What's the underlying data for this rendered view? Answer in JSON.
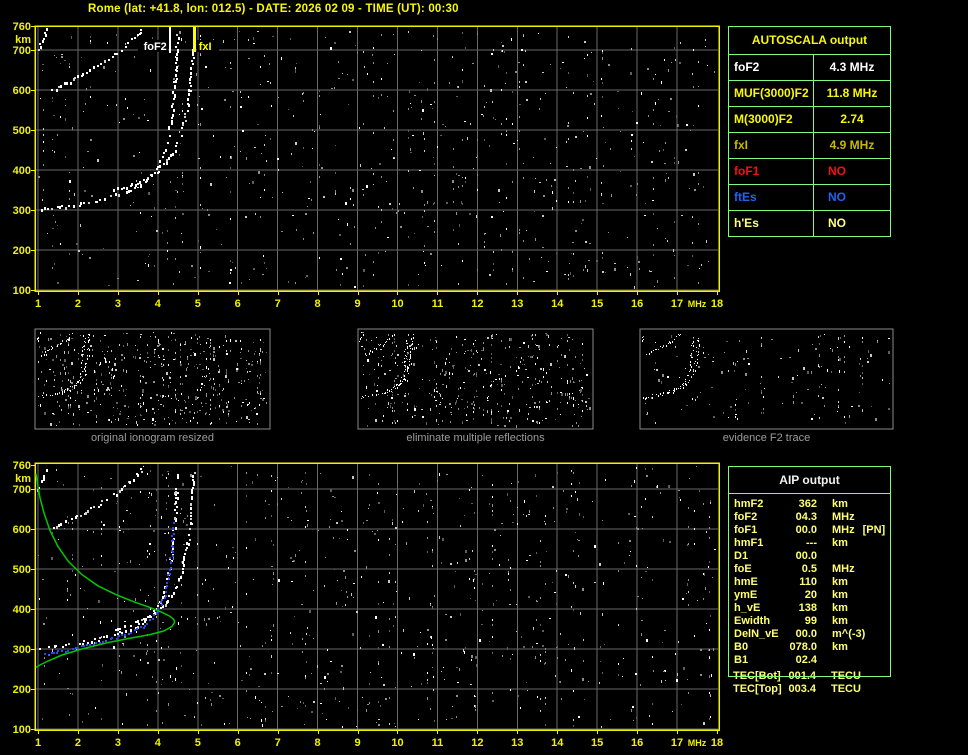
{
  "title": "Rome (lat: +41.8, lon: 012.5) - DATE: 2026 02 09 - TIME (UT): 00:30",
  "colors": {
    "background": "#000000",
    "title_yellow": "#f8f800",
    "axis_yellow": "#f2f200",
    "grid_gray": "#696969",
    "panel_border_gray": "#8a8a8a",
    "caption_gray": "#9c9c9c",
    "table_border_green": "#80fb80",
    "profile_green": "#00c800",
    "trace_blue": "#2a46f0",
    "status_red": "#f21212",
    "status_blue": "#1e64f0",
    "olive_yellow": "#c9b800",
    "pale_yellow": "#ffff73",
    "white": "#ffffff"
  },
  "autoscala_table": {
    "header": "AUTOSCALA output",
    "rows": [
      {
        "label": "foF2",
        "value": "4.3 MHz",
        "color": "#ffffff"
      },
      {
        "label": "MUF(3000)F2",
        "value": "11.8 MHz",
        "color": "#f8f800"
      },
      {
        "label": "M(3000)F2",
        "value": "2.74",
        "color": "#f8f800"
      },
      {
        "label": "fxI",
        "value": "4.9 MHz",
        "color": "#c9b800"
      },
      {
        "label": "foF1",
        "value": "NO",
        "color": "#f21212"
      },
      {
        "label": "ftEs",
        "value": "NO",
        "color": "#1e64f0"
      },
      {
        "label": "h'Es",
        "value": "NO",
        "color": "#ffff7a"
      }
    ]
  },
  "aip_table": {
    "header": "AIP output",
    "rows": [
      {
        "label": "hmF2",
        "value": "362",
        "unit": "km",
        "extra": ""
      },
      {
        "label": "foF2",
        "value": "04.3",
        "unit": "MHz",
        "extra": ""
      },
      {
        "label": "foF1",
        "value": "00.0",
        "unit": "MHz",
        "extra": "[PN]"
      },
      {
        "label": "hmF1",
        "value": "---",
        "unit": "km",
        "extra": ""
      },
      {
        "label": "D1",
        "value": "00.0",
        "unit": "",
        "extra": ""
      },
      {
        "label": "foE",
        "value": "0.5",
        "unit": "MHz",
        "extra": ""
      },
      {
        "label": "hmE",
        "value": "110",
        "unit": "km",
        "extra": ""
      },
      {
        "label": "ymE",
        "value": "20",
        "unit": "km",
        "extra": ""
      },
      {
        "label": "h_vE",
        "value": "138",
        "unit": "km",
        "extra": ""
      },
      {
        "label": "Ewidth",
        "value": "99",
        "unit": "km",
        "extra": ""
      },
      {
        "label": "DelN_vE",
        "value": "00.0",
        "unit": "m^(-3)",
        "extra": ""
      },
      {
        "label": "B0",
        "value": "078.0",
        "unit": "km",
        "extra": ""
      },
      {
        "label": "B1",
        "value": "02.4",
        "unit": "",
        "extra": ""
      }
    ],
    "tec_rows": [
      {
        "label": "TEC[Bot]",
        "value": "001.4",
        "unit": "TECU"
      },
      {
        "label": "TEC[Top]",
        "value": "003.4",
        "unit": "TECU"
      }
    ]
  },
  "panels": [
    {
      "caption": "original ionogram resized"
    },
    {
      "caption": "eliminate multiple reflections"
    },
    {
      "caption": "evidence F2 trace"
    }
  ],
  "chart_data": {
    "type": "scatter",
    "description": "Ionogram: echo virtual height (km) vs sounding frequency (MHz), shown in a top plot with foF2/fxI markers and a bottom plot with the autoscaled F2 trace (blue) and electron density profile (green)",
    "xlabel": "MHz",
    "ylabel": "km",
    "xlim": [
      1,
      18
    ],
    "ylim": [
      100,
      760
    ],
    "grid": true,
    "x_ticks": [
      1,
      2,
      3,
      4,
      5,
      6,
      7,
      8,
      9,
      10,
      11,
      12,
      13,
      14,
      15,
      16,
      17,
      18
    ],
    "y_ticks": [
      760,
      700,
      600,
      500,
      400,
      300,
      200,
      100
    ],
    "markers": [
      {
        "label": "foF2",
        "freq": 4.3,
        "color": "#ffffff"
      },
      {
        "label": "fxI",
        "freq": 4.9,
        "color": "#ffff00"
      }
    ],
    "traces": {
      "f2_o_mode_virtual_height": [
        [
          1.05,
          303
        ],
        [
          1.3,
          306
        ],
        [
          1.6,
          310
        ],
        [
          2.0,
          316
        ],
        [
          2.4,
          324
        ],
        [
          2.8,
          334
        ],
        [
          3.1,
          344
        ],
        [
          3.4,
          356
        ],
        [
          3.65,
          370
        ],
        [
          3.85,
          388
        ],
        [
          4.0,
          408
        ],
        [
          4.1,
          430
        ],
        [
          4.2,
          462
        ],
        [
          4.28,
          502
        ],
        [
          4.34,
          548
        ],
        [
          4.39,
          598
        ],
        [
          4.43,
          648
        ],
        [
          4.46,
          698
        ],
        [
          4.48,
          745
        ]
      ],
      "f2_x_mode_virtual_height": [
        [
          2.9,
          352
        ],
        [
          3.2,
          360
        ],
        [
          3.5,
          370
        ],
        [
          3.75,
          382
        ],
        [
          3.95,
          396
        ],
        [
          4.15,
          414
        ],
        [
          4.33,
          438
        ],
        [
          4.48,
          468
        ],
        [
          4.6,
          504
        ],
        [
          4.7,
          548
        ],
        [
          4.78,
          598
        ],
        [
          4.83,
          652
        ],
        [
          4.86,
          706
        ],
        [
          4.88,
          750
        ]
      ],
      "second_hop_reflection": [
        [
          1.35,
          602
        ],
        [
          1.7,
          620
        ],
        [
          2.05,
          638
        ],
        [
          2.4,
          657
        ],
        [
          2.75,
          678
        ],
        [
          3.05,
          700
        ],
        [
          3.3,
          722
        ],
        [
          3.55,
          746
        ],
        [
          3.63,
          760
        ]
      ],
      "second_hop_corner": [
        [
          1.0,
          700
        ],
        [
          1.08,
          722
        ],
        [
          1.17,
          744
        ],
        [
          1.24,
          760
        ]
      ],
      "autoscala_f2_trace_blue": [
        [
          1.15,
          287
        ],
        [
          1.5,
          295
        ],
        [
          1.9,
          303
        ],
        [
          2.3,
          312
        ],
        [
          2.7,
          322
        ],
        [
          3.0,
          332
        ],
        [
          3.3,
          344
        ],
        [
          3.6,
          358
        ],
        [
          3.8,
          374
        ],
        [
          3.95,
          392
        ],
        [
          4.05,
          412
        ],
        [
          4.15,
          438
        ],
        [
          4.22,
          468
        ],
        [
          4.28,
          500
        ],
        [
          4.32,
          535
        ],
        [
          4.35,
          570
        ],
        [
          4.37,
          600
        ],
        [
          4.38,
          625
        ]
      ],
      "electron_density_profile_green": [
        [
          0.95,
          738
        ],
        [
          1.0,
          706
        ],
        [
          1.05,
          678
        ],
        [
          1.15,
          640
        ],
        [
          1.3,
          596
        ],
        [
          1.5,
          556
        ],
        [
          1.75,
          520
        ],
        [
          2.1,
          486
        ],
        [
          2.5,
          458
        ],
        [
          2.95,
          436
        ],
        [
          3.4,
          418
        ],
        [
          3.8,
          404
        ],
        [
          4.1,
          392
        ],
        [
          4.3,
          382
        ],
        [
          4.4,
          374
        ],
        [
          4.42,
          366
        ],
        [
          4.35,
          356
        ],
        [
          4.15,
          345
        ],
        [
          3.8,
          336
        ],
        [
          3.3,
          327
        ],
        [
          2.7,
          315
        ],
        [
          2.1,
          300
        ],
        [
          1.6,
          285
        ],
        [
          1.25,
          270
        ],
        [
          1.05,
          260
        ],
        [
          0.95,
          254
        ]
      ]
    }
  }
}
